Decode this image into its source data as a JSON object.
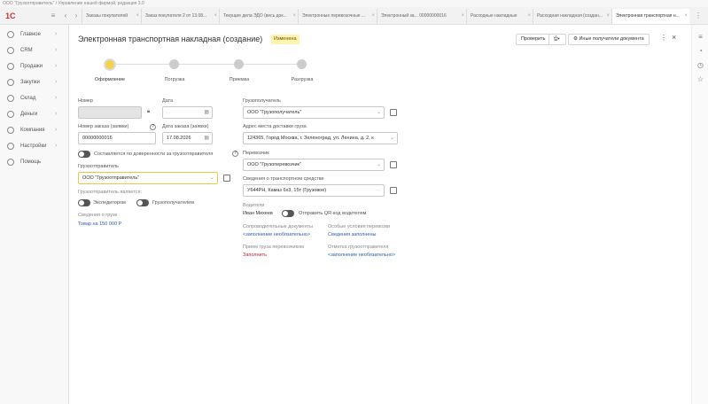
{
  "window_title": "ООО \"Грузоотправитель\" / Управление нашей фирмой, редакция 3.0",
  "logo": "1С",
  "tabs": [
    "Заказы покупателей",
    "Заказ покупателя 2 от 13.08...",
    "Текущие дела ЭДО (весь док...",
    "Электронные перевозочные ...",
    "Электронный за... 00000000016",
    "Расходные накладные",
    "Расходная накладная (создан...",
    "Электронная транспортная н..."
  ],
  "sidebar": {
    "items": [
      {
        "label": "Главное"
      },
      {
        "label": "CRM"
      },
      {
        "label": "Продажи"
      },
      {
        "label": "Закупки"
      },
      {
        "label": "Склад"
      },
      {
        "label": "Деньги"
      },
      {
        "label": "Компания"
      },
      {
        "label": "Настройки"
      },
      {
        "label": "Помощь"
      }
    ]
  },
  "header": {
    "title": "Электронная транспортная накладная (создание)",
    "status": "Изменена",
    "check_label": "Проверить",
    "other_recipients_label": "Иные получатели документа"
  },
  "steps": [
    {
      "label": "Оформление"
    },
    {
      "label": "Погрузка"
    },
    {
      "label": "Приемка"
    },
    {
      "label": "Разгрузка"
    }
  ],
  "form": {
    "number_label": "Номер",
    "number_value": "",
    "date_label": "Дата",
    "date_value": ". .",
    "order_number_label": "Номер заказа (заявки)",
    "order_number_value": "00000000016",
    "order_date_label": "Дата заказа (заявки)",
    "order_date_value": "17.08.2026",
    "proxy_toggle_label": "Составляется по доверенности за грузоотправителя",
    "shipper_label": "Грузоотправитель",
    "shipper_value": "ООО \"Грузоотправитель\"",
    "shipper_role_label": "Грузоотправитель является:",
    "role_forwarder": "Экспедитором",
    "role_consignee": "Грузополучателем",
    "cargo_label": "Сведения о грузе",
    "cargo_link": "Товар на 150 000 Р",
    "consignee_label": "Грузополучатель",
    "consignee_value": "ООО \"Грузополучатель\"",
    "address_label": "Адрес места доставки груза",
    "address_value": "124365, Город Москва, г. Зеленоград, ул. Ленина, д. 2, к",
    "carrier_label": "Перевозчик",
    "carrier_value": "ООО \"Грузоперевозчик\"",
    "vehicle_label": "Сведения о транспортном средстве",
    "vehicle_value": "У644РН, Камаз 6х3, 15т (Грузовое)",
    "drivers_label": "Водители",
    "driver_name": "Иван Михеев",
    "qr_label": "Отправить QR-код водителям",
    "accompanying_label": "Сопроводительные документы",
    "accompanying_link": "<заполнение необязательно>",
    "conditions_label": "Особые условия перевозки",
    "conditions_link": "Сведения заполнены",
    "acceptance_label": "Прием груза перевозчиком",
    "acceptance_link": "Заполнить",
    "shipper_mark_label": "Отметка грузоотправителя",
    "shipper_mark_link": "<заполнение необязательно>"
  },
  "colors": {
    "accent_yellow": "#f2d24a",
    "status_bg": "#fff3b0",
    "link_blue": "#2a5db0",
    "required_red": "#b5222b"
  },
  "icons": [
    "gear-icon",
    "close-icon",
    "bell-icon",
    "history-icon",
    "star-icon",
    "more-icon"
  ]
}
